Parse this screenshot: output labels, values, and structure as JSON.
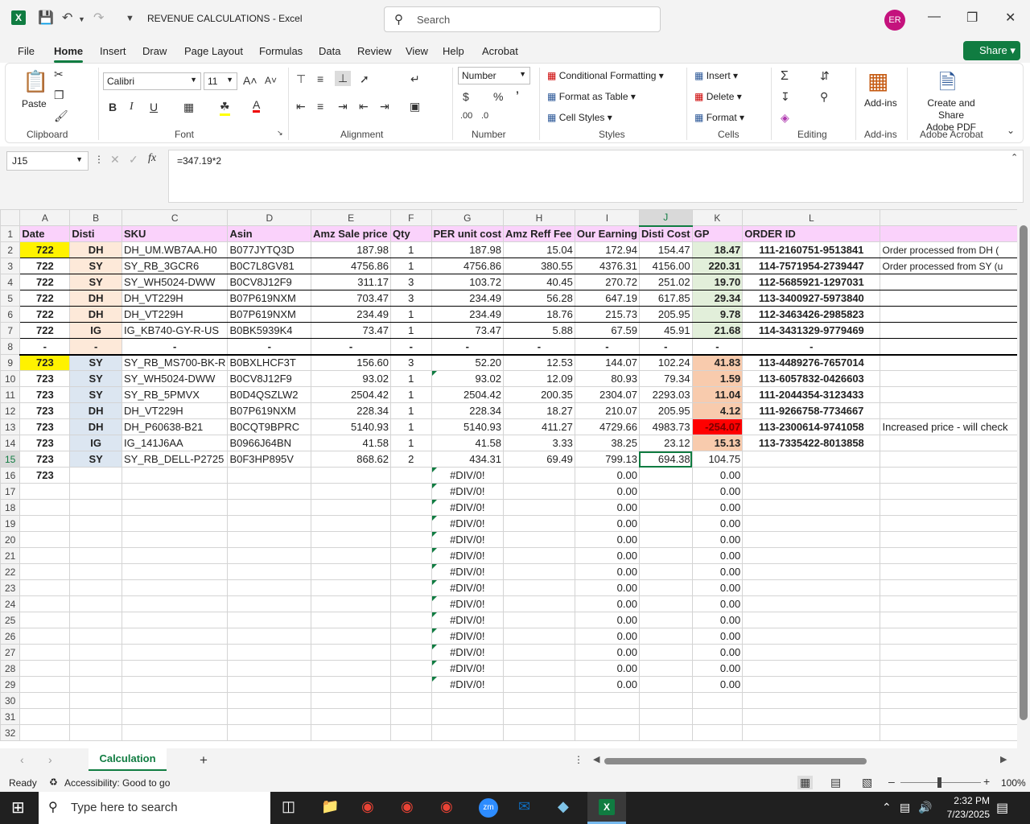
{
  "title": {
    "file": "REVENUE CALCULATIONS",
    "sep": "-",
    "app": "Excel"
  },
  "search": {
    "placeholder": "Search"
  },
  "user": {
    "initials": "ER"
  },
  "menu": [
    "File",
    "Home",
    "Insert",
    "Draw",
    "Page Layout",
    "Formulas",
    "Data",
    "Review",
    "View",
    "Help",
    "Acrobat"
  ],
  "share_label": "Share",
  "ribbon": {
    "paste": "Paste",
    "font_name": "Calibri",
    "font_size": "11",
    "number_format": "Number",
    "conditional_formatting": "Conditional Formatting",
    "format_as_table": "Format as Table",
    "cell_styles": "Cell Styles",
    "insert": "Insert",
    "delete": "Delete",
    "format": "Format",
    "addins": "Add-ins",
    "create_share_pdf_1": "Create and Share",
    "create_share_pdf_2": "Adobe PDF",
    "groups": {
      "clipboard": "Clipboard",
      "font": "Font",
      "alignment": "Alignment",
      "number": "Number",
      "styles": "Styles",
      "cells": "Cells",
      "editing": "Editing",
      "addins": "Add-ins",
      "acrobat": "Adobe Acrobat"
    }
  },
  "formula_bar": {
    "name_box": "J15",
    "formula": "=347.19*2"
  },
  "columns": [
    "A",
    "B",
    "C",
    "D",
    "E",
    "F",
    "G",
    "H",
    "I",
    "J",
    "K",
    "L",
    ""
  ],
  "rows": [
    {
      "n": "1",
      "cells": [
        "Date",
        "Disti",
        "SKU",
        "Asin",
        "Amz Sale price",
        "Qty",
        "PER unit cost",
        "Amz Reff Fee",
        "Our Earning",
        "Disti Cost",
        "GP",
        "ORDER ID",
        ""
      ]
    },
    {
      "n": "2",
      "cells": [
        "722",
        "DH",
        "DH_UM.WB7AA.H0",
        "B077JYTQ3D",
        "187.98",
        "1",
        "187.98",
        "15.04",
        "172.94",
        "154.47",
        "18.47",
        "111-2160751-9513841",
        "Order processed from DH ("
      ]
    },
    {
      "n": "3",
      "cells": [
        "722",
        "SY",
        "SY_RB_3GCR6",
        "B0C7L8GV81",
        "4756.86",
        "1",
        "4756.86",
        "380.55",
        "4376.31",
        "4156.00",
        "220.31",
        "114-7571954-2739447",
        "Order processed from SY (u"
      ]
    },
    {
      "n": "4",
      "cells": [
        "722",
        "SY",
        "SY_WH5024-DWW",
        "B0CV8J12F9",
        "311.17",
        "3",
        "103.72",
        "40.45",
        "270.72",
        "251.02",
        "19.70",
        "112-5685921-1297031",
        ""
      ]
    },
    {
      "n": "5",
      "cells": [
        "722",
        "DH",
        "DH_VT229H",
        "B07P619NXM",
        "703.47",
        "3",
        "234.49",
        "56.28",
        "647.19",
        "617.85",
        "29.34",
        "113-3400927-5973840",
        ""
      ]
    },
    {
      "n": "6",
      "cells": [
        "722",
        "DH",
        "DH_VT229H",
        "B07P619NXM",
        "234.49",
        "1",
        "234.49",
        "18.76",
        "215.73",
        "205.95",
        "9.78",
        "112-3463426-2985823",
        ""
      ]
    },
    {
      "n": "7",
      "cells": [
        "722",
        "IG",
        "IG_KB740-GY-R-US",
        "B0BK5939K4",
        "73.47",
        "1",
        "73.47",
        "5.88",
        "67.59",
        "45.91",
        "21.68",
        "114-3431329-9779469",
        ""
      ]
    },
    {
      "n": "8",
      "cells": [
        "-",
        "-",
        "-",
        "-",
        "-",
        "-",
        "-",
        "-",
        "-",
        "-",
        "-",
        "-",
        ""
      ]
    },
    {
      "n": "9",
      "cells": [
        "723",
        "SY",
        "SY_RB_MS700-BK-R",
        "B0BXLHCF3T",
        "156.60",
        "3",
        "52.20",
        "12.53",
        "144.07",
        "102.24",
        "41.83",
        "113-4489276-7657014",
        ""
      ]
    },
    {
      "n": "10",
      "cells": [
        "723",
        "SY",
        "SY_WH5024-DWW",
        "B0CV8J12F9",
        "93.02",
        "1",
        "93.02",
        "12.09",
        "80.93",
        "79.34",
        "1.59",
        "113-6057832-0426603",
        ""
      ]
    },
    {
      "n": "11",
      "cells": [
        "723",
        "SY",
        "SY_RB_5PMVX",
        "B0D4QSZLW2",
        "2504.42",
        "1",
        "2504.42",
        "200.35",
        "2304.07",
        "2293.03",
        "11.04",
        "111-2044354-3123433",
        ""
      ]
    },
    {
      "n": "12",
      "cells": [
        "723",
        "DH",
        "DH_VT229H",
        "B07P619NXM",
        "228.34",
        "1",
        "228.34",
        "18.27",
        "210.07",
        "205.95",
        "4.12",
        "111-9266758-7734667",
        ""
      ]
    },
    {
      "n": "13",
      "cells": [
        "723",
        "DH",
        "DH_P60638-B21",
        "B0CQT9BPRC",
        "5140.93",
        "1",
        "5140.93",
        "411.27",
        "4729.66",
        "4983.73",
        "-254.07",
        "113-2300614-9741058",
        "Increased price - will check"
      ]
    },
    {
      "n": "14",
      "cells": [
        "723",
        "IG",
        "IG_141J6AA",
        "B0966J64BN",
        "41.58",
        "1",
        "41.58",
        "3.33",
        "38.25",
        "23.12",
        "15.13",
        "113-7335422-8013858",
        ""
      ]
    },
    {
      "n": "15",
      "cells": [
        "723",
        "SY",
        "SY_RB_DELL-P2725",
        "B0F3HP895V",
        "868.62",
        "2",
        "434.31",
        "69.49",
        "799.13",
        "694.38",
        "104.75",
        "",
        ""
      ]
    },
    {
      "n": "16",
      "cells": [
        "723",
        "",
        "",
        "",
        "",
        "",
        "#DIV/0!",
        "",
        "0.00",
        "",
        "0.00",
        "",
        ""
      ]
    },
    {
      "n": "17",
      "cells": [
        "",
        "",
        "",
        "",
        "",
        "",
        "#DIV/0!",
        "",
        "0.00",
        "",
        "0.00",
        "",
        ""
      ]
    },
    {
      "n": "18",
      "cells": [
        "",
        "",
        "",
        "",
        "",
        "",
        "#DIV/0!",
        "",
        "0.00",
        "",
        "0.00",
        "",
        ""
      ]
    },
    {
      "n": "19",
      "cells": [
        "",
        "",
        "",
        "",
        "",
        "",
        "#DIV/0!",
        "",
        "0.00",
        "",
        "0.00",
        "",
        ""
      ]
    },
    {
      "n": "20",
      "cells": [
        "",
        "",
        "",
        "",
        "",
        "",
        "#DIV/0!",
        "",
        "0.00",
        "",
        "0.00",
        "",
        ""
      ]
    },
    {
      "n": "21",
      "cells": [
        "",
        "",
        "",
        "",
        "",
        "",
        "#DIV/0!",
        "",
        "0.00",
        "",
        "0.00",
        "",
        ""
      ]
    },
    {
      "n": "22",
      "cells": [
        "",
        "",
        "",
        "",
        "",
        "",
        "#DIV/0!",
        "",
        "0.00",
        "",
        "0.00",
        "",
        ""
      ]
    },
    {
      "n": "23",
      "cells": [
        "",
        "",
        "",
        "",
        "",
        "",
        "#DIV/0!",
        "",
        "0.00",
        "",
        "0.00",
        "",
        ""
      ]
    },
    {
      "n": "24",
      "cells": [
        "",
        "",
        "",
        "",
        "",
        "",
        "#DIV/0!",
        "",
        "0.00",
        "",
        "0.00",
        "",
        ""
      ]
    },
    {
      "n": "25",
      "cells": [
        "",
        "",
        "",
        "",
        "",
        "",
        "#DIV/0!",
        "",
        "0.00",
        "",
        "0.00",
        "",
        ""
      ]
    },
    {
      "n": "26",
      "cells": [
        "",
        "",
        "",
        "",
        "",
        "",
        "#DIV/0!",
        "",
        "0.00",
        "",
        "0.00",
        "",
        ""
      ]
    },
    {
      "n": "27",
      "cells": [
        "",
        "",
        "",
        "",
        "",
        "",
        "#DIV/0!",
        "",
        "0.00",
        "",
        "0.00",
        "",
        ""
      ]
    },
    {
      "n": "28",
      "cells": [
        "",
        "",
        "",
        "",
        "",
        "",
        "#DIV/0!",
        "",
        "0.00",
        "",
        "0.00",
        "",
        ""
      ]
    },
    {
      "n": "29",
      "cells": [
        "",
        "",
        "",
        "",
        "",
        "",
        "#DIV/0!",
        "",
        "0.00",
        "",
        "0.00",
        "",
        ""
      ]
    },
    {
      "n": "30",
      "cells": [
        "",
        "",
        "",
        "",
        "",
        "",
        "",
        "",
        "",
        "",
        "",
        "",
        ""
      ]
    },
    {
      "n": "31",
      "cells": [
        "",
        "",
        "",
        "",
        "",
        "",
        "",
        "",
        "",
        "",
        "",
        "",
        ""
      ]
    },
    {
      "n": "32",
      "cells": [
        "",
        "",
        "",
        "",
        "",
        "",
        "",
        "",
        "",
        "",
        "",
        "",
        ""
      ]
    }
  ],
  "sheet_tab": "Calculation",
  "status": {
    "ready": "Ready",
    "accessibility": "Accessibility: Good to go",
    "zoom": "100%"
  },
  "taskbar": {
    "search_placeholder": "Type here to search",
    "time": "2:32 PM",
    "date": "7/23/2025"
  },
  "colors": {
    "excel_green": "#107c41",
    "header_pink": "#fad2fb",
    "highlight_yellow": "#fff200",
    "negative_red": "#ff0000"
  }
}
